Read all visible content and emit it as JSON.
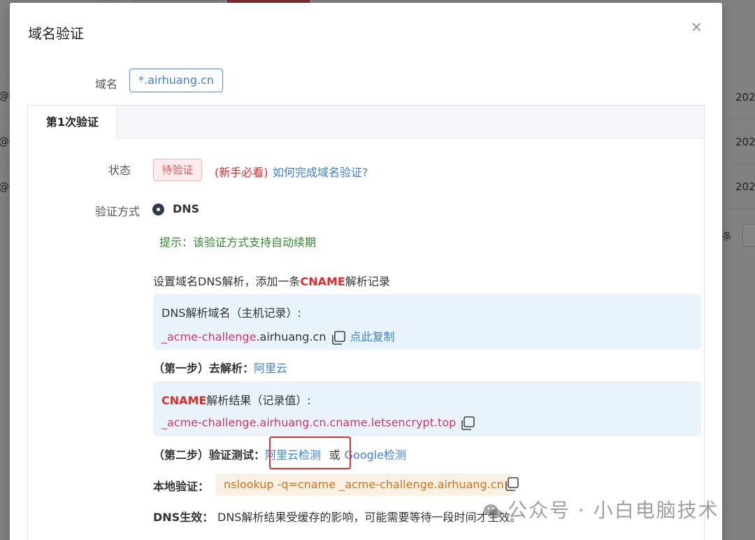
{
  "background": {
    "rows_left": [
      "@c",
      "@c",
      "@c"
    ],
    "rows_right": [
      "202",
      "202",
      "202"
    ],
    "pager_text": "条"
  },
  "dialog": {
    "title": "域名验证",
    "close_glyph": "×",
    "domain_label": "域名",
    "domain_value": "*.airhuang.cn",
    "tab_label": "第1次验证",
    "status_label": "状态",
    "status_badge": "待验证",
    "newbie_text": "(新手必看)",
    "howto_link": "如何完成域名验证?",
    "method_label": "验证方式",
    "method_value": "DNS",
    "tip": "提示：该验证方式支持自动续期",
    "instruction_pre": "设置域名DNS解析，添加一条",
    "instruction_highlight": "CNAME",
    "instruction_post": "解析记录",
    "host_record": {
      "title": "DNS解析域名（主机记录）:",
      "value_highlight": "_acme-challenge",
      "value_rest": ".airhuang.cn",
      "copy_label": "点此复制"
    },
    "step1": {
      "label": "（第一步）去解析：",
      "link": "阿里云"
    },
    "cname_record": {
      "title_highlight": "CNAME",
      "title_rest": "解析结果（记录值）:",
      "value": "_acme-challenge.airhuang.cn.cname.letsencrypt.top"
    },
    "step2": {
      "label": "（第二步）验证测试：",
      "link_aliyun": "阿里云检测",
      "or": "或",
      "link_google": "Google检测"
    },
    "local_verify": {
      "label": "本地验证：",
      "command": "nslookup -q=cname _acme-challenge.airhuang.cn"
    },
    "dns_effect": {
      "label": "DNS生效：",
      "text": "DNS解析结果受缓存的影响，可能需要等待一段时间才生效。"
    }
  },
  "watermark": "公众号 · 小白电脑技术",
  "colors": {
    "accent_blue": "#3b82d9",
    "red": "#e02b2b",
    "green": "#2e8b2e",
    "orange": "#d9731a",
    "pink": "#d6336c",
    "info_bg": "#e8f3fb"
  }
}
